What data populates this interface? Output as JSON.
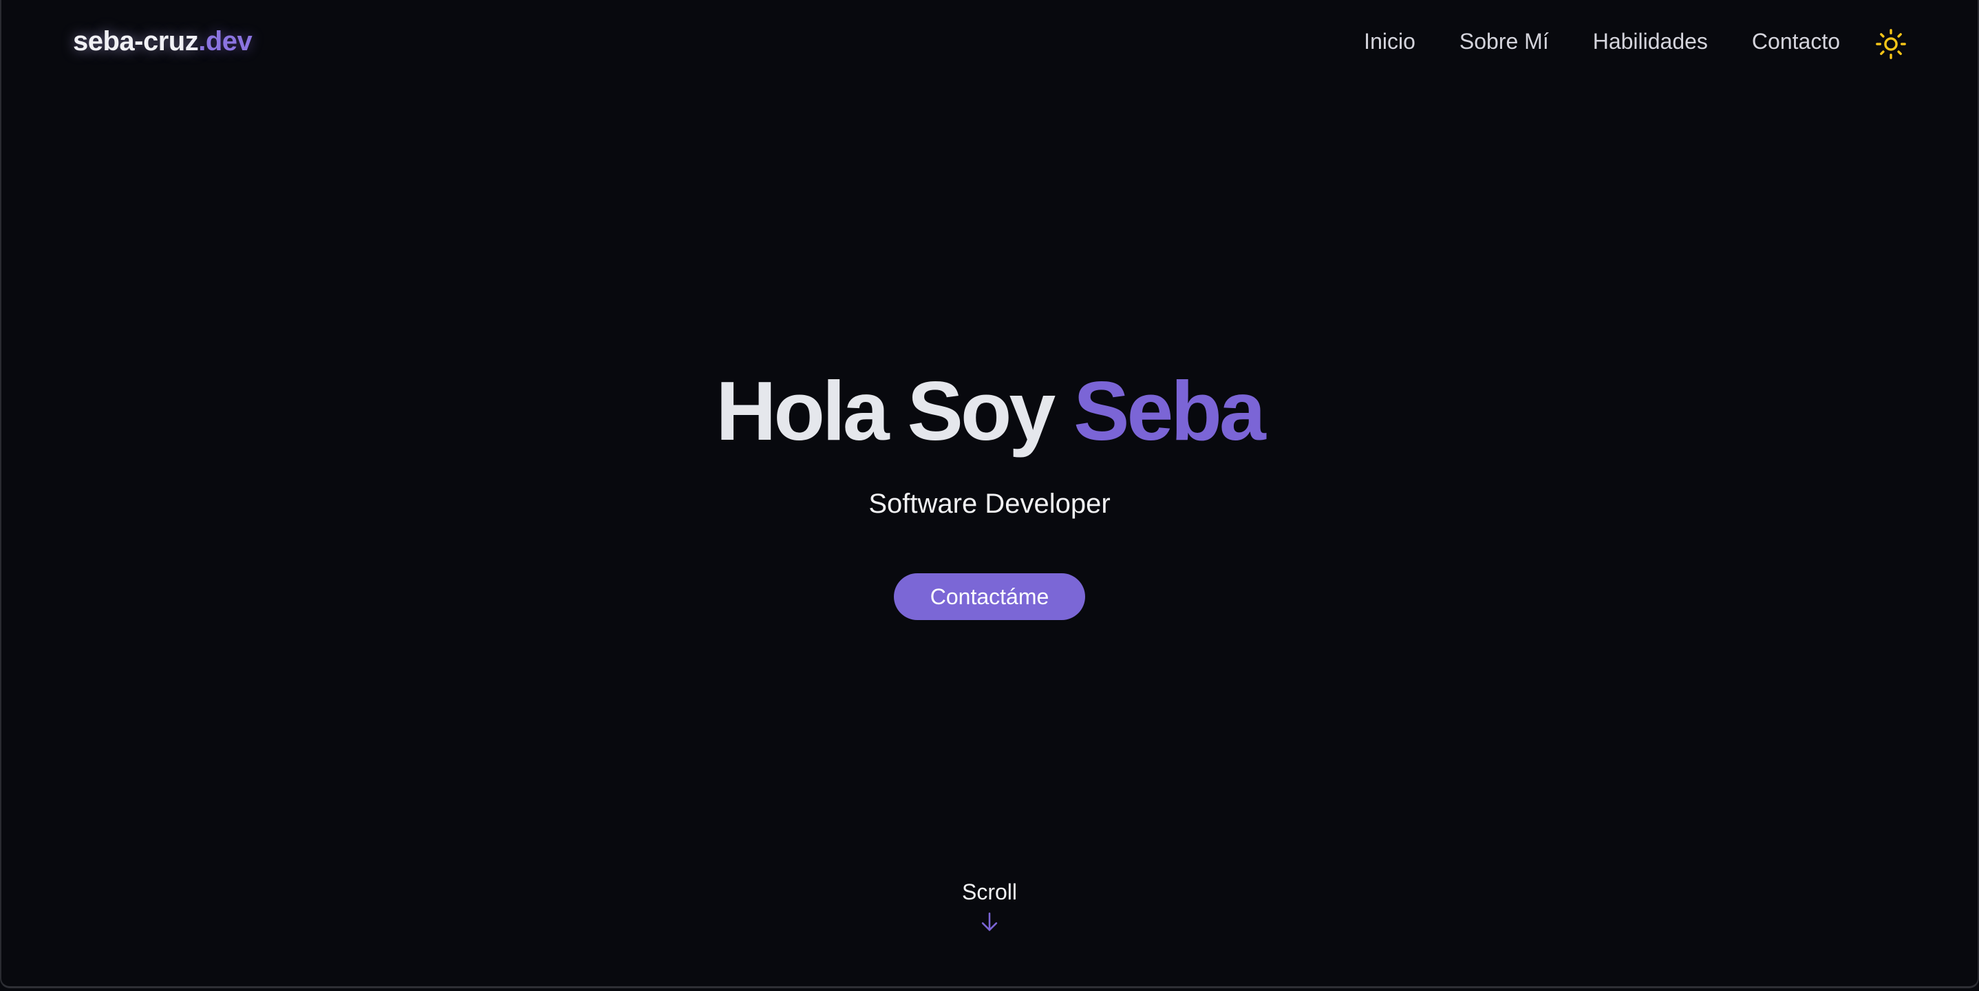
{
  "brand": {
    "name": "seba-cruz",
    "suffix": ".dev"
  },
  "nav": {
    "items": [
      {
        "label": "Inicio"
      },
      {
        "label": "Sobre Mí"
      },
      {
        "label": "Habilidades"
      },
      {
        "label": "Contacto"
      }
    ],
    "theme_toggle_icon": "sun-icon"
  },
  "hero": {
    "greeting": "Hola Soy",
    "name": "Seba",
    "subtitle": "Software Developer",
    "cta_label": "Contactáme"
  },
  "scroll": {
    "label": "Scroll",
    "icon": "arrow-down-icon"
  },
  "colors": {
    "background": "#08090e",
    "accent": "#7b65d6",
    "sun": "#f5c518",
    "text": "#e5e7ec"
  }
}
